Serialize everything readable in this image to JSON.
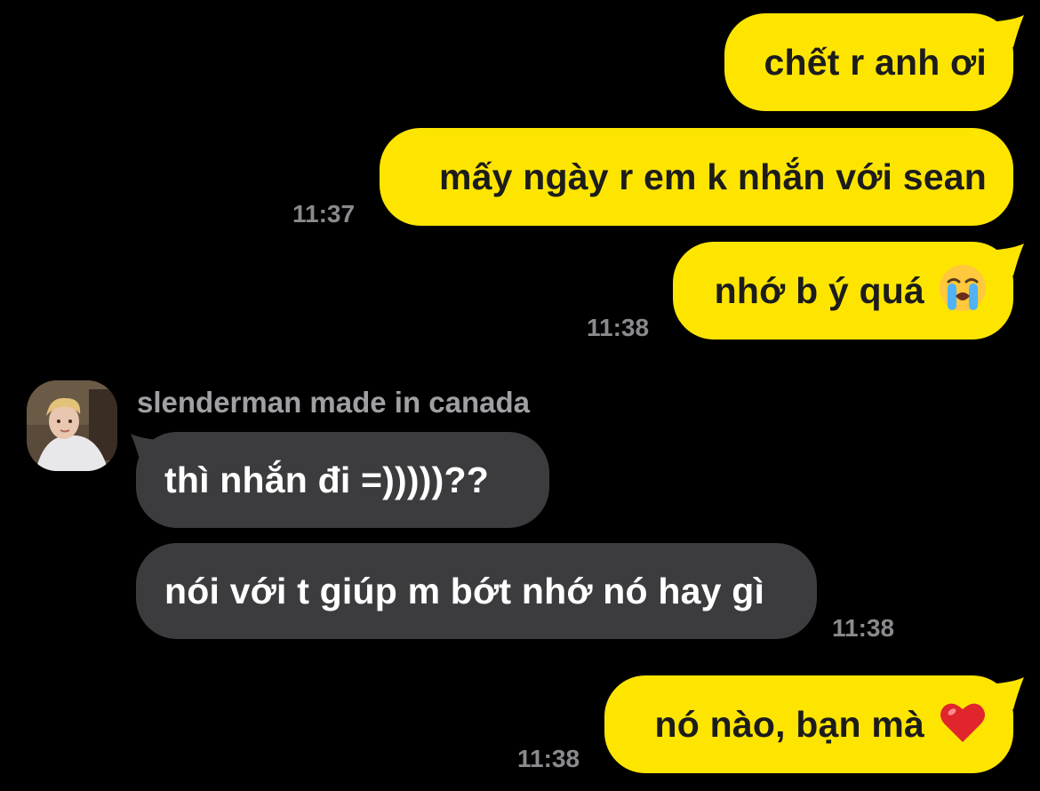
{
  "chat": {
    "messages": [
      {
        "direction": "outgoing",
        "text": "chết r anh ơi",
        "time": ""
      },
      {
        "direction": "outgoing",
        "text": "mấy ngày r em k nhắn với sean",
        "time": "11:37"
      },
      {
        "direction": "outgoing",
        "text": "nhớ b ý quá",
        "emoji": "loudly-crying-face",
        "time": "11:38"
      },
      {
        "direction": "incoming",
        "text": "thì nhắn đi =)))))??",
        "time": ""
      },
      {
        "direction": "incoming",
        "text": "nói với t giúp m bớt nhớ nó hay gì",
        "time": "11:38"
      },
      {
        "direction": "outgoing",
        "text": "nó nào, bạn mà",
        "emoji": "red-heart",
        "time": "11:38"
      }
    ],
    "contact": {
      "name": "slenderman made in canada",
      "avatar": "profile-photo"
    }
  },
  "colors": {
    "background": "#000000",
    "outgoing_bubble": "#fee500",
    "incoming_bubble": "#3c3c3f",
    "timestamp": "#8a8a8e",
    "sender_name": "#a0a0a4"
  }
}
